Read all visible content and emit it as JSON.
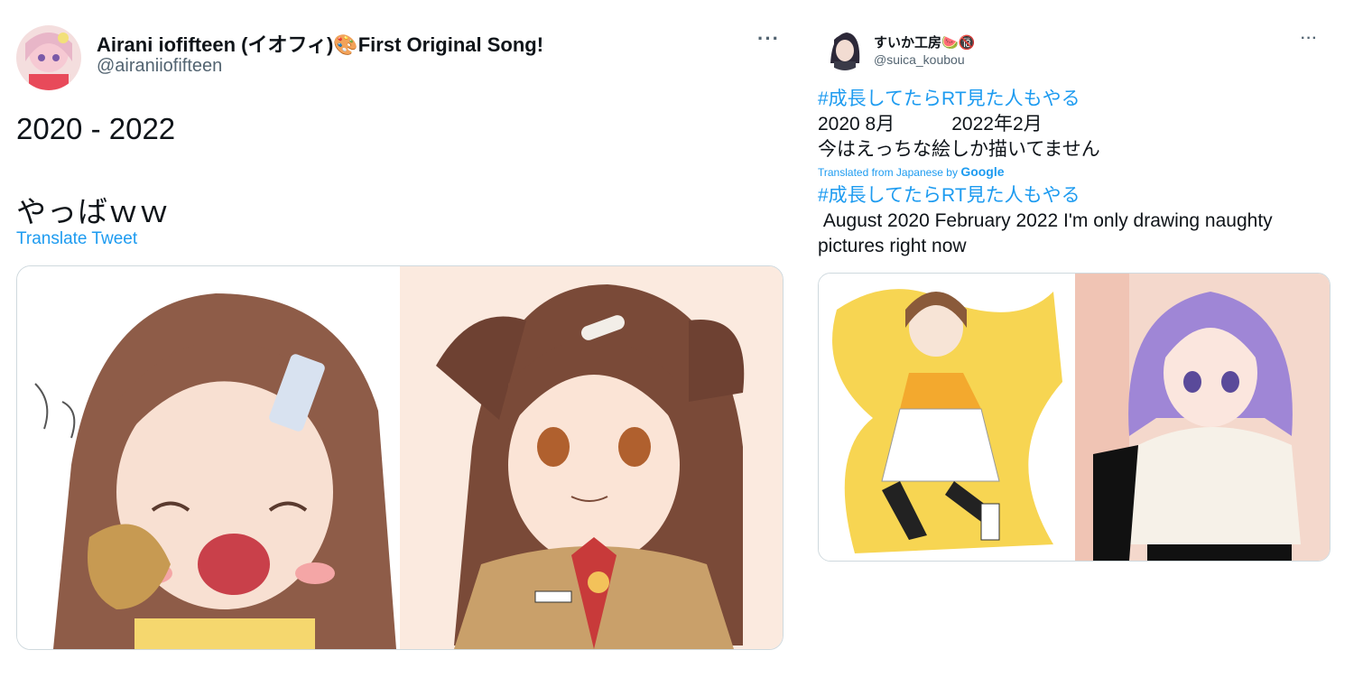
{
  "tweet1": {
    "display_name": "Airani iofifteen (イオフィ)🎨First Original Song!",
    "handle": "@airaniiofifteen",
    "more": "···",
    "text_line1": "2020 - 2022",
    "text_line2": "やっばｗｗ",
    "translate_label": "Translate Tweet",
    "media_images": [
      "chibi dog-ear girl eating bread",
      "dog-ear girl in uniform"
    ]
  },
  "tweet2": {
    "display_name": "すいか工房🍉🔞",
    "handle": "@suica_koubou",
    "more": "···",
    "hashtag": "#成長してたらRT見た人もやる",
    "line2": "2020 8月　　　2022年2月",
    "line3": "今はえっちな絵しか描いてません",
    "translated_from": "Translated from Japanese by ",
    "google": "Google",
    "translated_hashtag": "#成長してたらRT見た人もやる",
    "translated_text": " August 2020 February 2022 I'm only drawing naughty pictures right now",
    "media_images": [
      "girl jumping on yellow background",
      "purple-haired girl"
    ]
  },
  "colors": {
    "link": "#1d9bf0",
    "secondary": "#536471",
    "border": "#cfd9de"
  }
}
